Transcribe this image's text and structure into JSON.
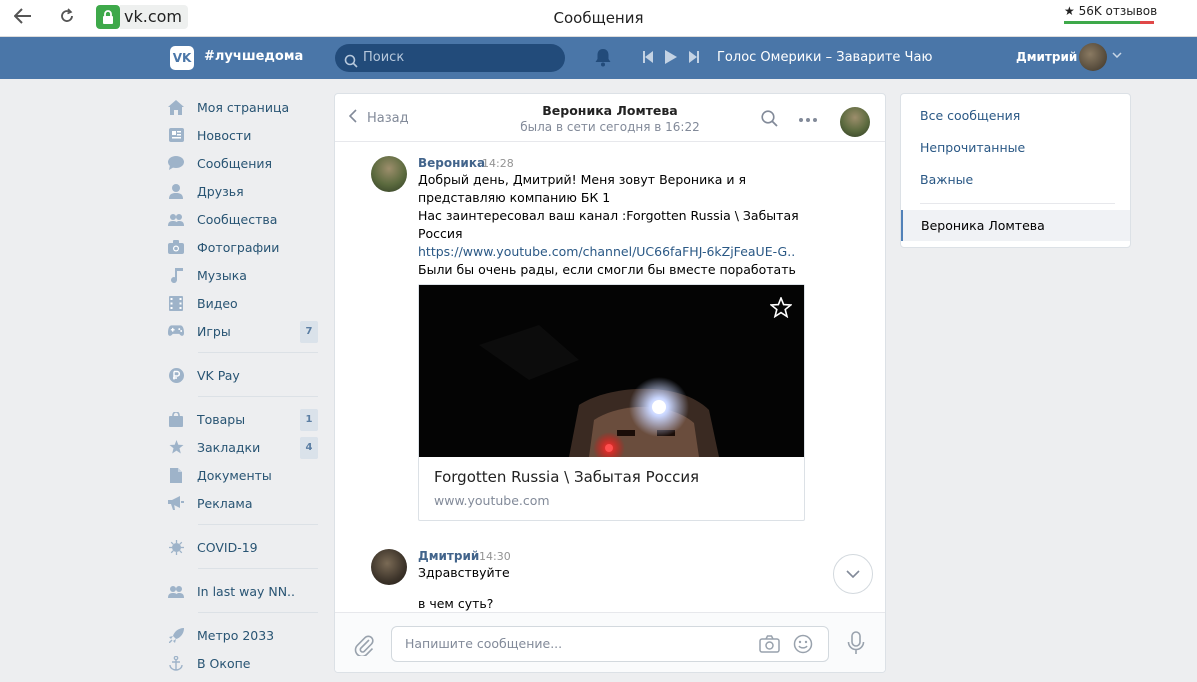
{
  "browser": {
    "url": "vk.com",
    "title": "Сообщения",
    "reviews": "★ 56K отзывов"
  },
  "header": {
    "tag": "#лучшедома",
    "search_placeholder": "Поиск",
    "track": "Голос Омерики – Заварите Чаю",
    "user_name": "Дмитрий"
  },
  "menu": {
    "items": [
      {
        "label": "Моя страница",
        "icon": "home-icon"
      },
      {
        "label": "Новости",
        "icon": "news-icon"
      },
      {
        "label": "Сообщения",
        "icon": "messages-icon"
      },
      {
        "label": "Друзья",
        "icon": "friends-icon"
      },
      {
        "label": "Сообщества",
        "icon": "communities-icon"
      },
      {
        "label": "Фотографии",
        "icon": "camera-icon"
      },
      {
        "label": "Музыка",
        "icon": "music-icon"
      },
      {
        "label": "Видео",
        "icon": "video-icon"
      },
      {
        "label": "Игры",
        "icon": "gamepad-icon",
        "count": "7"
      },
      {
        "label": "VK Pay",
        "icon": "vkpay-icon"
      },
      {
        "label": "Товары",
        "icon": "bag-icon",
        "count": "1"
      },
      {
        "label": "Закладки",
        "icon": "star-icon",
        "count": "4"
      },
      {
        "label": "Документы",
        "icon": "document-icon"
      },
      {
        "label": "Реклама",
        "icon": "megaphone-icon"
      },
      {
        "label": "COVID-19",
        "icon": "virus-icon"
      },
      {
        "label": "In last way NN..",
        "icon": "group-icon"
      },
      {
        "label": "Метро 2033",
        "icon": "rocket-icon"
      },
      {
        "label": "В Окопе",
        "icon": "anchor-icon"
      }
    ]
  },
  "chat": {
    "back_label": "Назад",
    "peer_name": "Вероника Ломтева",
    "peer_status": "была в сети сегодня в 16:22",
    "messages": [
      {
        "author": "Вероника",
        "time": "14:28",
        "lines": [
          "Добрый день, Дмитрий! Меня зовут Вероника и я",
          "представляю компанию БК 1",
          "Нас заинтересовал ваш канал :Forgotten Russia \\ Забытая",
          "Россия",
          "https://www.youtube.com/channel/UC66faFHJ-6kZjFeaUE-G..",
          "Были бы очень рады, если смогли бы вместе поработать"
        ],
        "attachment": {
          "title": "Forgotten Russia \\ Забытая Россия",
          "domain": "www.youtube.com"
        }
      },
      {
        "author": "Дмитрий",
        "time": "14:30",
        "lines": [
          "Здравствуйте",
          "в чем суть?"
        ]
      }
    ],
    "compose_placeholder": "Напишите сообщение..."
  },
  "right": {
    "items": [
      "Все сообщения",
      "Непрочитанные",
      "Важные"
    ],
    "selected": "Вероника Ломтева"
  },
  "colors": {
    "header_bg": "#4a76a8",
    "link": "#2a5885",
    "page_bg": "#edeef0",
    "secure_green": "#3ea94a"
  }
}
